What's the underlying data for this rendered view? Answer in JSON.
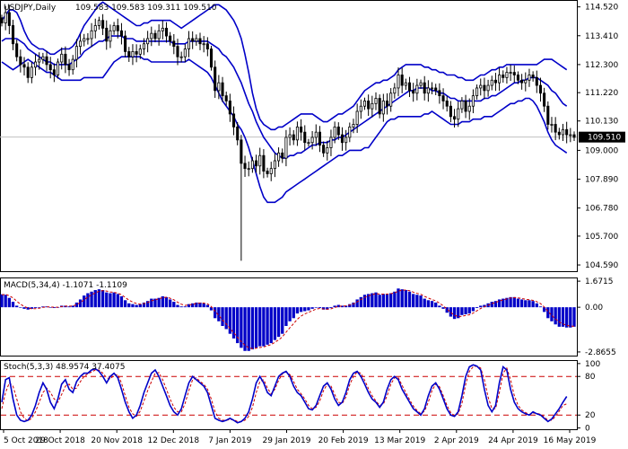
{
  "colors": {
    "background": "#ffffff",
    "frame": "#000000",
    "candles": "#000000",
    "bollinger": "#0000c8",
    "macd_hist": "#0000c8",
    "macd_signal": "#cc0000",
    "stoch_main": "#0000c8",
    "stoch_signal": "#cc0000",
    "stoch_levels": "#cc0000",
    "price_line": "#c0c0c0",
    "price_box": "#000000"
  },
  "chart_data": [
    {
      "type": "candlestick",
      "title": "USDJPY,Daily",
      "ohlc_label": "109.583 109.583 109.311 109.510",
      "indicators": [
        "Bollinger Bands"
      ],
      "current_price": 109.51,
      "current_price_label": "109.510",
      "ylim": [
        104.35,
        114.75
      ],
      "ytick_labels": [
        "114.520",
        "113.410",
        "112.300",
        "111.220",
        "110.130",
        "109.000",
        "107.890",
        "106.780",
        "105.700",
        "104.590"
      ],
      "ytick_values": [
        114.52,
        113.41,
        112.3,
        111.22,
        110.13,
        109.0,
        107.89,
        106.78,
        105.7,
        104.59
      ],
      "xtick_labels": [
        "5 Oct 2018",
        "29 Oct 2018",
        "20 Nov 2018",
        "12 Dec 2018",
        "7 Jan 2019",
        "29 Jan 2019",
        "20 Feb 2019",
        "13 Mar 2019",
        "2 Apr 2019",
        "24 Apr 2019",
        "16 May 2019"
      ],
      "close": [
        113.9,
        114.3,
        113.8,
        113.1,
        112.6,
        112.3,
        112.2,
        111.8,
        112.2,
        112.4,
        112.5,
        112.6,
        112.3,
        112.1,
        111.9,
        112.4,
        112.7,
        112.3,
        112.1,
        112.5,
        113.0,
        113.2,
        113.3,
        113.3,
        113.6,
        113.8,
        114.0,
        113.7,
        113.2,
        113.6,
        113.8,
        113.6,
        113.4,
        112.8,
        112.6,
        112.8,
        112.7,
        112.9,
        113.1,
        113.3,
        113.5,
        113.3,
        113.6,
        113.7,
        113.4,
        113.2,
        113.0,
        112.6,
        112.6,
        112.9,
        113.3,
        113.2,
        113.3,
        113.1,
        113.1,
        112.9,
        112.2,
        111.3,
        111.6,
        111.1,
        110.9,
        110.4,
        109.9,
        109.4,
        108.5,
        108.3,
        108.3,
        108.6,
        108.4,
        108.8,
        108.2,
        108.1,
        108.3,
        108.6,
        108.9,
        108.7,
        109.5,
        109.6,
        109.4,
        109.9,
        109.7,
        109.3,
        109.3,
        109.5,
        109.7,
        109.2,
        108.9,
        109.1,
        109.5,
        109.9,
        109.6,
        109.3,
        109.5,
        109.9,
        110.0,
        110.5,
        110.7,
        110.9,
        110.6,
        110.8,
        111.0,
        110.4,
        110.9,
        110.7,
        111.2,
        111.4,
        111.9,
        111.5,
        111.6,
        111.3,
        111.2,
        111.5,
        111.6,
        111.2,
        111.4,
        111.4,
        111.3,
        111.1,
        110.9,
        110.7,
        110.3,
        110.2,
        110.6,
        110.9,
        110.5,
        110.7,
        111.1,
        111.4,
        111.5,
        111.3,
        111.5,
        111.7,
        111.6,
        111.9,
        111.8,
        112.0,
        112.0,
        111.9,
        111.7,
        111.6,
        111.7,
        111.9,
        111.8,
        111.5,
        111.2,
        110.7,
        110.0,
        110.0,
        109.7,
        109.6,
        109.8,
        109.6,
        109.6,
        109.5
      ],
      "bollinger_upper": [
        114.0,
        114.2,
        114.4,
        114.4,
        114.3,
        114.0,
        113.6,
        113.3,
        113.1,
        113.0,
        112.9,
        112.9,
        112.8,
        112.7,
        112.7,
        112.8,
        112.9,
        112.9,
        112.9,
        113.0,
        113.2,
        113.5,
        113.8,
        114.0,
        114.2,
        114.4,
        114.6,
        114.7,
        114.6,
        114.5,
        114.4,
        114.3,
        114.2,
        114.1,
        114.0,
        113.9,
        113.8,
        113.8,
        113.9,
        113.9,
        114.0,
        114.0,
        114.0,
        114.0,
        114.0,
        114.0,
        113.9,
        113.8,
        113.7,
        113.8,
        113.9,
        114.0,
        114.1,
        114.2,
        114.3,
        114.4,
        114.5,
        114.6,
        114.6,
        114.5,
        114.4,
        114.2,
        114.0,
        113.7,
        113.3,
        112.7,
        112.0,
        111.2,
        110.6,
        110.2,
        110.0,
        109.9,
        109.8,
        109.8,
        109.9,
        109.9,
        110.0,
        110.1,
        110.2,
        110.3,
        110.4,
        110.4,
        110.4,
        110.4,
        110.3,
        110.2,
        110.1,
        110.1,
        110.2,
        110.3,
        110.4,
        110.4,
        110.5,
        110.6,
        110.7,
        110.9,
        111.1,
        111.3,
        111.4,
        111.5,
        111.6,
        111.6,
        111.7,
        111.7,
        111.8,
        111.9,
        112.1,
        112.2,
        112.3,
        112.3,
        112.3,
        112.3,
        112.3,
        112.2,
        112.2,
        112.1,
        112.1,
        112.0,
        112.0,
        111.9,
        111.9,
        111.9,
        111.8,
        111.8,
        111.7,
        111.7,
        111.7,
        111.8,
        111.9,
        111.9,
        112.0,
        112.1,
        112.1,
        112.2,
        112.2,
        112.3,
        112.3,
        112.3,
        112.3,
        112.3,
        112.3,
        112.3,
        112.3,
        112.3,
        112.4,
        112.5,
        112.5,
        112.5,
        112.4,
        112.3,
        112.2,
        112.1
      ],
      "bollinger_middle": [
        113.2,
        113.3,
        113.3,
        113.3,
        113.3,
        113.2,
        113.1,
        112.9,
        112.8,
        112.7,
        112.6,
        112.5,
        112.4,
        112.4,
        112.3,
        112.3,
        112.3,
        112.3,
        112.3,
        112.4,
        112.5,
        112.6,
        112.8,
        112.9,
        113.0,
        113.1,
        113.2,
        113.2,
        113.3,
        113.4,
        113.4,
        113.4,
        113.4,
        113.3,
        113.3,
        113.3,
        113.2,
        113.2,
        113.2,
        113.2,
        113.2,
        113.2,
        113.2,
        113.2,
        113.2,
        113.2,
        113.1,
        113.1,
        113.1,
        113.1,
        113.2,
        113.2,
        113.2,
        113.2,
        113.2,
        113.2,
        113.1,
        113.0,
        112.9,
        112.7,
        112.6,
        112.4,
        112.2,
        111.9,
        111.6,
        111.2,
        110.8,
        110.5,
        110.1,
        109.8,
        109.5,
        109.3,
        109.1,
        108.9,
        108.8,
        108.7,
        108.7,
        108.8,
        108.8,
        108.9,
        108.9,
        109.0,
        109.1,
        109.2,
        109.2,
        109.3,
        109.3,
        109.3,
        109.4,
        109.4,
        109.5,
        109.5,
        109.6,
        109.7,
        109.8,
        109.9,
        110.0,
        110.1,
        110.2,
        110.3,
        110.4,
        110.5,
        110.6,
        110.7,
        110.8,
        110.9,
        111.0,
        111.1,
        111.2,
        111.3,
        111.3,
        111.4,
        111.4,
        111.4,
        111.4,
        111.3,
        111.3,
        111.2,
        111.2,
        111.1,
        111.0,
        111.0,
        110.9,
        110.9,
        110.9,
        110.9,
        110.9,
        110.9,
        110.9,
        111.0,
        111.0,
        111.1,
        111.1,
        111.2,
        111.3,
        111.4,
        111.5,
        111.6,
        111.6,
        111.7,
        111.7,
        111.8,
        111.8,
        111.8,
        111.7,
        111.6,
        111.5,
        111.3,
        111.2,
        111.0,
        110.8,
        110.7
      ],
      "bollinger_lower": [
        112.4,
        112.3,
        112.2,
        112.1,
        112.2,
        112.3,
        112.4,
        112.5,
        112.4,
        112.3,
        112.2,
        112.1,
        112.0,
        112.0,
        111.9,
        111.8,
        111.7,
        111.7,
        111.7,
        111.7,
        111.7,
        111.7,
        111.8,
        111.8,
        111.8,
        111.8,
        111.8,
        111.8,
        112.0,
        112.2,
        112.4,
        112.5,
        112.6,
        112.6,
        112.6,
        112.6,
        112.6,
        112.6,
        112.5,
        112.5,
        112.4,
        112.4,
        112.4,
        112.4,
        112.4,
        112.4,
        112.4,
        112.4,
        112.4,
        112.4,
        112.5,
        112.4,
        112.3,
        112.2,
        112.1,
        112.0,
        111.8,
        111.5,
        111.2,
        110.9,
        110.7,
        110.5,
        110.3,
        110.0,
        109.8,
        109.5,
        109.1,
        108.6,
        108.1,
        107.6,
        107.2,
        107.0,
        107.0,
        107.0,
        107.1,
        107.2,
        107.4,
        107.5,
        107.6,
        107.7,
        107.8,
        107.9,
        108.0,
        108.1,
        108.2,
        108.3,
        108.4,
        108.5,
        108.6,
        108.7,
        108.8,
        108.8,
        108.9,
        109.0,
        109.0,
        109.0,
        109.0,
        109.1,
        109.1,
        109.3,
        109.5,
        109.7,
        109.9,
        110.1,
        110.2,
        110.2,
        110.3,
        110.3,
        110.3,
        110.3,
        110.3,
        110.3,
        110.3,
        110.4,
        110.4,
        110.5,
        110.4,
        110.3,
        110.2,
        110.1,
        110.0,
        110.0,
        110.0,
        110.1,
        110.1,
        110.1,
        110.2,
        110.2,
        110.2,
        110.3,
        110.3,
        110.3,
        110.4,
        110.5,
        110.6,
        110.7,
        110.8,
        110.8,
        110.9,
        110.9,
        111.0,
        111.0,
        110.9,
        110.7,
        110.4,
        110.1,
        109.7,
        109.4,
        109.2,
        109.1,
        109.0,
        108.9
      ]
    },
    {
      "type": "bar",
      "title": "MACD(5,34,4) -1.1071 -1.1109",
      "ylim": [
        -3.1,
        1.85
      ],
      "ytick_labels": [
        "1.6715",
        "0.00",
        "-2.8655"
      ],
      "ytick_values": [
        1.6715,
        0.0,
        -2.8655
      ],
      "histogram": [
        0.83,
        0.8,
        0.6,
        0.35,
        0.1,
        0.0,
        -0.1,
        -0.15,
        -0.1,
        -0.05,
        0.0,
        0.05,
        0.05,
        0.0,
        -0.05,
        0.0,
        0.1,
        0.1,
        0.05,
        0.1,
        0.3,
        0.5,
        0.75,
        0.9,
        1.0,
        1.1,
        1.15,
        1.1,
        0.95,
        0.9,
        0.95,
        0.85,
        0.7,
        0.45,
        0.25,
        0.2,
        0.15,
        0.2,
        0.3,
        0.4,
        0.55,
        0.55,
        0.6,
        0.7,
        0.65,
        0.5,
        0.35,
        0.15,
        0.05,
        0.05,
        0.2,
        0.25,
        0.3,
        0.3,
        0.25,
        0.15,
        -0.2,
        -0.7,
        -0.9,
        -1.2,
        -1.4,
        -1.7,
        -2.0,
        -2.3,
        -2.6,
        -2.8,
        -2.8,
        -2.7,
        -2.6,
        -2.5,
        -2.5,
        -2.4,
        -2.3,
        -2.1,
        -1.9,
        -1.7,
        -1.2,
        -0.9,
        -0.7,
        -0.4,
        -0.3,
        -0.25,
        -0.2,
        -0.1,
        0.0,
        -0.05,
        -0.15,
        -0.15,
        -0.05,
        0.1,
        0.15,
        0.1,
        0.1,
        0.2,
        0.3,
        0.5,
        0.65,
        0.8,
        0.85,
        0.9,
        0.95,
        0.8,
        0.85,
        0.85,
        0.9,
        1.0,
        1.2,
        1.15,
        1.1,
        1.0,
        0.85,
        0.8,
        0.75,
        0.55,
        0.45,
        0.4,
        0.3,
        0.1,
        -0.1,
        -0.35,
        -0.6,
        -0.75,
        -0.7,
        -0.5,
        -0.45,
        -0.4,
        -0.25,
        -0.05,
        0.1,
        0.15,
        0.25,
        0.35,
        0.4,
        0.5,
        0.55,
        0.6,
        0.65,
        0.65,
        0.55,
        0.5,
        0.45,
        0.45,
        0.4,
        0.25,
        0.05,
        -0.3,
        -0.7,
        -0.9,
        -1.1,
        -1.25,
        -1.25,
        -1.3,
        -1.3,
        -1.25
      ],
      "signal": [
        0.8,
        0.82,
        0.74,
        0.6,
        0.38,
        0.2,
        0.05,
        -0.05,
        -0.1,
        -0.09,
        -0.06,
        -0.01,
        0.02,
        0.02,
        0.0,
        0.0,
        0.04,
        0.07,
        0.07,
        0.08,
        0.17,
        0.3,
        0.48,
        0.65,
        0.8,
        0.92,
        1.02,
        1.07,
        1.04,
        0.98,
        0.95,
        0.9,
        0.8,
        0.63,
        0.45,
        0.33,
        0.24,
        0.2,
        0.23,
        0.3,
        0.41,
        0.48,
        0.54,
        0.62,
        0.64,
        0.58,
        0.48,
        0.32,
        0.19,
        0.12,
        0.15,
        0.19,
        0.24,
        0.27,
        0.27,
        0.22,
        0.04,
        -0.25,
        -0.52,
        -0.82,
        -1.07,
        -1.36,
        -1.63,
        -1.92,
        -2.2,
        -2.43,
        -2.6,
        -2.65,
        -2.63,
        -2.58,
        -2.54,
        -2.47,
        -2.39,
        -2.25,
        -2.09,
        -1.9,
        -1.6,
        -1.31,
        -1.05,
        -0.77,
        -0.57,
        -0.43,
        -0.33,
        -0.22,
        -0.12,
        -0.08,
        -0.11,
        -0.13,
        -0.1,
        -0.02,
        0.06,
        0.08,
        0.09,
        0.14,
        0.22,
        0.35,
        0.49,
        0.63,
        0.73,
        0.81,
        0.87,
        0.84,
        0.84,
        0.84,
        0.87,
        0.92,
        1.04,
        1.09,
        1.1,
        1.06,
        0.97,
        0.89,
        0.83,
        0.7,
        0.59,
        0.5,
        0.41,
        0.26,
        0.09,
        -0.11,
        -0.33,
        -0.51,
        -0.6,
        -0.58,
        -0.53,
        -0.48,
        -0.38,
        -0.23,
        -0.08,
        0.03,
        0.13,
        0.23,
        0.31,
        0.4,
        0.47,
        0.53,
        0.59,
        0.62,
        0.6,
        0.56,
        0.51,
        0.48,
        0.44,
        0.36,
        0.23,
        0.02,
        -0.26,
        -0.52,
        -0.75,
        -0.95,
        -1.07,
        -1.16,
        -1.21,
        -1.22
      ]
    },
    {
      "type": "line",
      "title": "Stoch(5,3,3) 48.9574 37.4075",
      "ylim": [
        -2,
        104
      ],
      "ytick_labels": [
        "100",
        "80",
        "20",
        "0"
      ],
      "ytick_values": [
        100,
        80,
        20,
        0
      ],
      "levels": [
        80,
        20
      ],
      "main": [
        40,
        75,
        78,
        45,
        20,
        12,
        10,
        12,
        20,
        35,
        55,
        70,
        60,
        40,
        30,
        45,
        68,
        75,
        60,
        55,
        72,
        80,
        85,
        85,
        90,
        92,
        88,
        80,
        70,
        80,
        85,
        78,
        60,
        40,
        25,
        15,
        20,
        35,
        55,
        70,
        85,
        90,
        80,
        65,
        50,
        35,
        25,
        20,
        30,
        50,
        70,
        80,
        75,
        70,
        65,
        55,
        35,
        15,
        12,
        10,
        12,
        15,
        12,
        8,
        10,
        15,
        25,
        45,
        70,
        80,
        70,
        55,
        50,
        65,
        80,
        85,
        88,
        80,
        65,
        55,
        50,
        40,
        30,
        28,
        35,
        50,
        65,
        70,
        60,
        45,
        35,
        40,
        55,
        75,
        85,
        88,
        80,
        68,
        55,
        45,
        40,
        32,
        40,
        60,
        75,
        80,
        75,
        60,
        50,
        40,
        30,
        25,
        20,
        30,
        50,
        65,
        70,
        60,
        45,
        30,
        20,
        18,
        25,
        50,
        80,
        95,
        98,
        96,
        90,
        60,
        35,
        25,
        35,
        70,
        95,
        90,
        60,
        40,
        30,
        25,
        22,
        20,
        25,
        22,
        20,
        15,
        10,
        14,
        22,
        30,
        40,
        48.96
      ],
      "signal": [
        30,
        55,
        70,
        65,
        45,
        25,
        15,
        11,
        15,
        25,
        40,
        55,
        62,
        55,
        45,
        40,
        52,
        65,
        68,
        60,
        62,
        72,
        80,
        84,
        87,
        90,
        90,
        85,
        78,
        76,
        82,
        83,
        70,
        50,
        32,
        22,
        18,
        26,
        42,
        58,
        72,
        85,
        86,
        75,
        60,
        45,
        32,
        25,
        25,
        38,
        58,
        75,
        78,
        72,
        68,
        60,
        45,
        25,
        15,
        12,
        12,
        13,
        13,
        10,
        10,
        12,
        18,
        32,
        55,
        72,
        75,
        62,
        53,
        60,
        74,
        84,
        87,
        83,
        72,
        60,
        53,
        45,
        35,
        30,
        32,
        42,
        58,
        68,
        65,
        52,
        40,
        38,
        48,
        67,
        80,
        87,
        85,
        74,
        61,
        50,
        42,
        35,
        37,
        50,
        68,
        78,
        78,
        66,
        55,
        44,
        34,
        27,
        22,
        26,
        40,
        58,
        68,
        64,
        50,
        35,
        24,
        19,
        22,
        38,
        68,
        88,
        95,
        96,
        93,
        75,
        48,
        30,
        30,
        55,
        85,
        93,
        75,
        50,
        35,
        28,
        24,
        21,
        23,
        23,
        21,
        17,
        12,
        12,
        18,
        26,
        35,
        37.41
      ]
    }
  ]
}
